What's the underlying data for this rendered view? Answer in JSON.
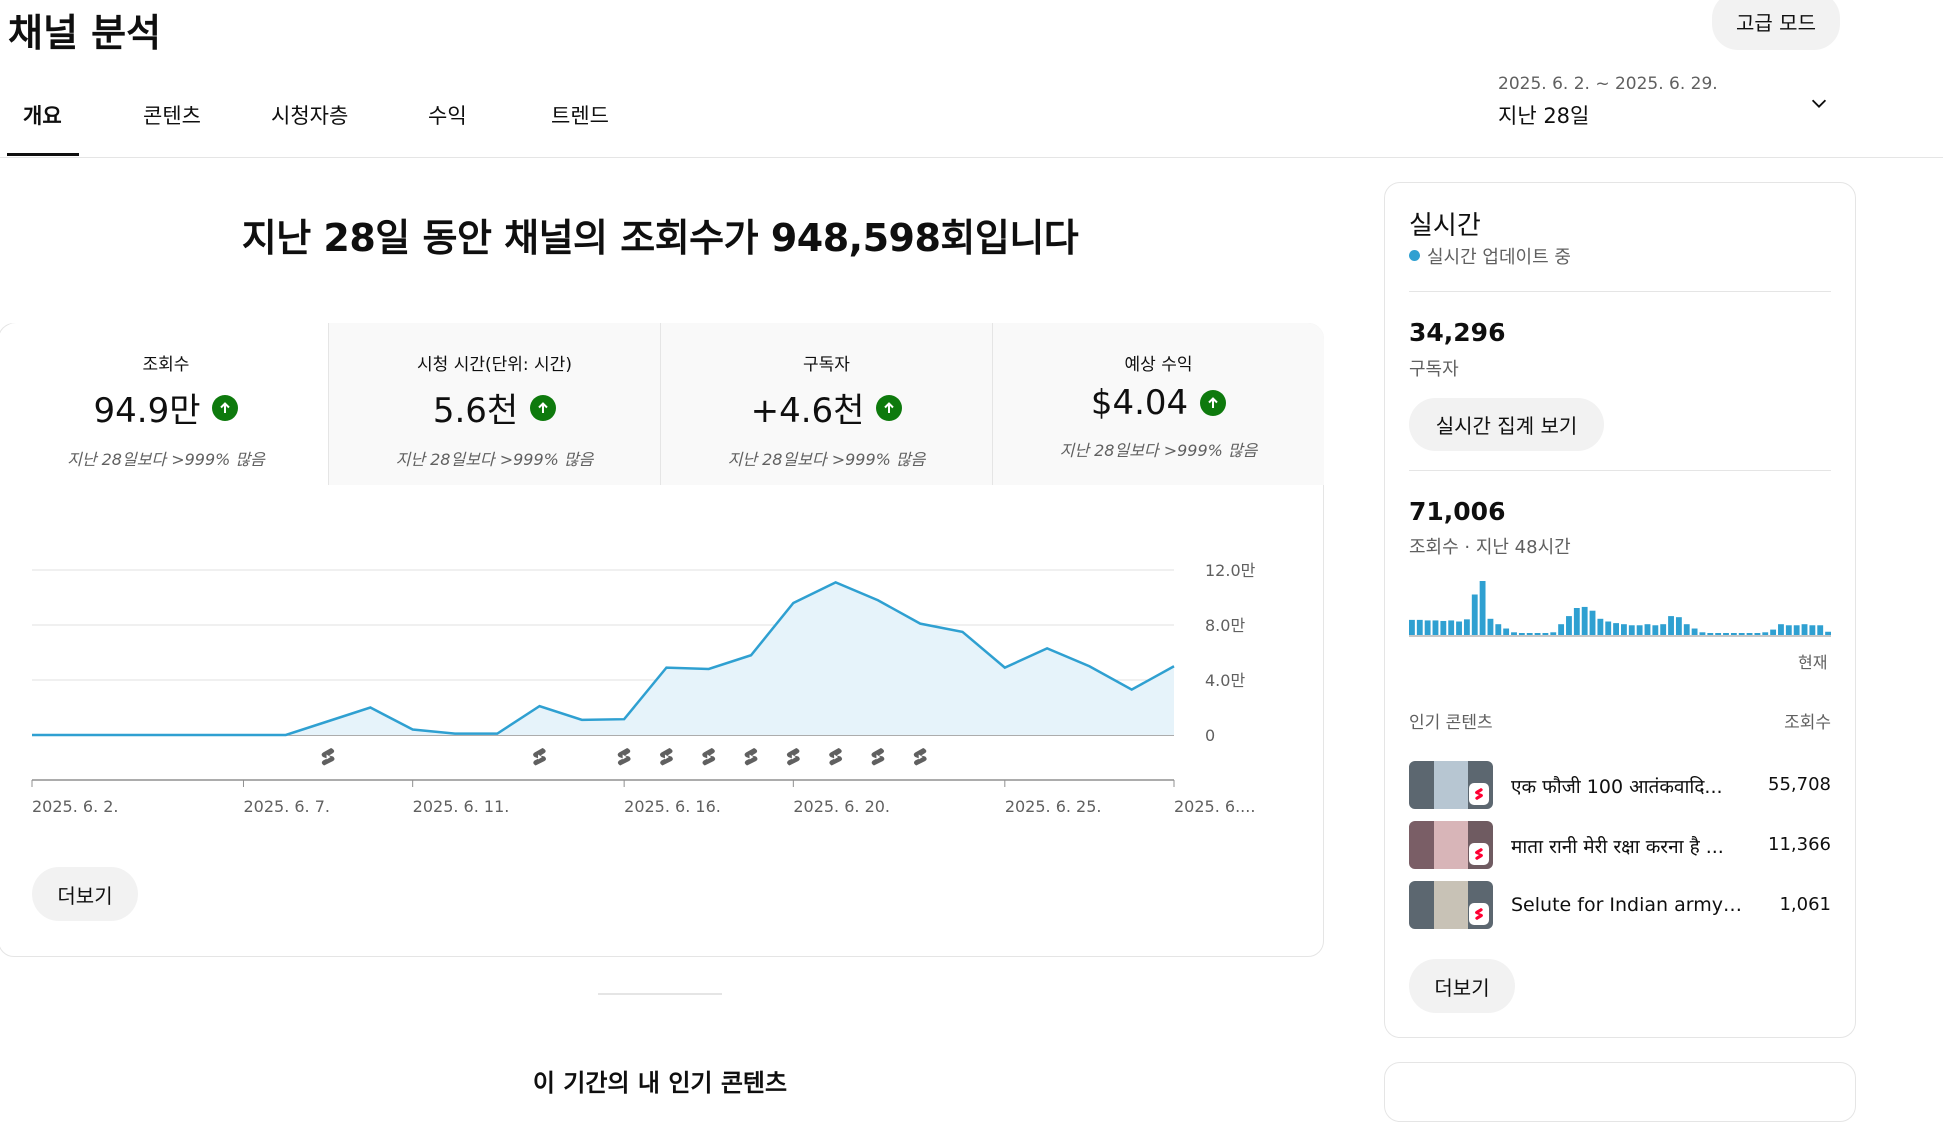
{
  "header": {
    "title": "채널 분석",
    "advanced_mode": "고급 모드",
    "tabs": [
      {
        "label": "개요",
        "active": true
      },
      {
        "label": "콘텐츠"
      },
      {
        "label": "시청자층"
      },
      {
        "label": "수익"
      },
      {
        "label": "트렌드"
      }
    ],
    "date_range": "2025. 6. 2. ~ 2025. 6. 29.",
    "period_label": "지난 28일",
    "dropdown_icon": "chevron-down-icon"
  },
  "overview": {
    "headline": "지난 28일 동안 채널의 조회수가 948,598회입니다",
    "metrics": [
      {
        "label": "조회수",
        "value": "94.9만",
        "compare": "지난 28일보다 >999% 많음"
      },
      {
        "label": "시청 시간(단위: 시간)",
        "value": "5.6천",
        "compare": "지난 28일보다 >999% 많음"
      },
      {
        "label": "구독자",
        "value": "+4.6천",
        "compare": "지난 28일보다 >999% 많음"
      },
      {
        "label": "예상 수익",
        "value": "$4.04",
        "compare": "지난 28일보다 >999% 많음"
      }
    ],
    "more_label": "더보기"
  },
  "chart_data": {
    "type": "area",
    "x": [
      "2025. 6. 2.",
      "2025. 6. 3.",
      "2025. 6. 4.",
      "2025. 6. 5.",
      "2025. 6. 6.",
      "2025. 6. 7.",
      "2025. 6. 8.",
      "2025. 6. 9.",
      "2025. 6. 10.",
      "2025. 6. 11.",
      "2025. 6. 12.",
      "2025. 6. 13.",
      "2025. 6. 14.",
      "2025. 6. 15.",
      "2025. 6. 16.",
      "2025. 6. 17.",
      "2025. 6. 18.",
      "2025. 6. 19.",
      "2025. 6. 20.",
      "2025. 6. 21.",
      "2025. 6. 22.",
      "2025. 6. 23.",
      "2025. 6. 24.",
      "2025. 6. 25.",
      "2025. 6. 26.",
      "2025. 6. 27.",
      "2025. 6. 28.",
      "2025. 6. 29."
    ],
    "values": [
      0,
      0,
      0,
      0,
      0,
      0,
      0,
      10000,
      20000,
      4000,
      1000,
      1000,
      21000,
      11000,
      11500,
      49000,
      48000,
      58000,
      96000,
      111000,
      98000,
      81000,
      75000,
      49000,
      63000,
      50000,
      33000,
      50000
    ],
    "y_ticks": [
      "0",
      "4.0만",
      "8.0만",
      "12.0만"
    ],
    "ylim": [
      0,
      120000
    ],
    "x_tick_labels": [
      {
        "label": "2025. 6. 2.",
        "index": 0
      },
      {
        "label": "2025. 6. 7.",
        "index": 5
      },
      {
        "label": "2025. 6. 11.",
        "index": 9
      },
      {
        "label": "2025. 6. 16.",
        "index": 14
      },
      {
        "label": "2025. 6. 20.",
        "index": 18
      },
      {
        "label": "2025. 6. 25.",
        "index": 23
      },
      {
        "label": "2025. 6....",
        "index": 27
      }
    ],
    "shorts_marker_indices": [
      7,
      12,
      14,
      15,
      16,
      17,
      18,
      19,
      20,
      21
    ],
    "grid": true,
    "line_color": "#2fa0d1",
    "fill_color": "#e6f3fa"
  },
  "realtime": {
    "title": "실시간",
    "live_label": "실시간 업데이트 중",
    "subscribers_value": "34,296",
    "subscribers_label": "구독자",
    "realtime_button": "실시간 집계 보기",
    "views_value": "71,006",
    "views_label": "조회수 · 지난 48시간",
    "hourly_bars": [
      0.28,
      0.28,
      0.27,
      0.27,
      0.26,
      0.27,
      0.25,
      0.29,
      0.75,
      1.0,
      0.3,
      0.2,
      0.12,
      0.05,
      0.03,
      0.02,
      0.02,
      0.03,
      0.05,
      0.2,
      0.35,
      0.5,
      0.52,
      0.45,
      0.3,
      0.25,
      0.22,
      0.2,
      0.18,
      0.18,
      0.2,
      0.18,
      0.2,
      0.35,
      0.33,
      0.2,
      0.12,
      0.05,
      0.02,
      0.02,
      0.02,
      0.02,
      0.02,
      0.02,
      0.02,
      0.05,
      0.1,
      0.2,
      0.18,
      0.18,
      0.2,
      0.18,
      0.18,
      0.06
    ],
    "now_label": "현재",
    "popular_header": "인기 콘텐츠",
    "popular_count_header": "조회수",
    "popular_items": [
      {
        "title": "एक फौजी 100 आतंकवादि...",
        "views": "55,708"
      },
      {
        "title": "माता रानी मेरी रक्षा करना है ...",
        "views": "11,366"
      },
      {
        "title": "Selute for Indian army 🪖 ...",
        "views": "1,061"
      }
    ],
    "more_label": "더보기"
  },
  "below": {
    "top_content_title": "이 기간의 내 인기 콘텐츠"
  },
  "colors": {
    "accent": "#2fa0d1",
    "up_green": "#0e7a0d"
  }
}
